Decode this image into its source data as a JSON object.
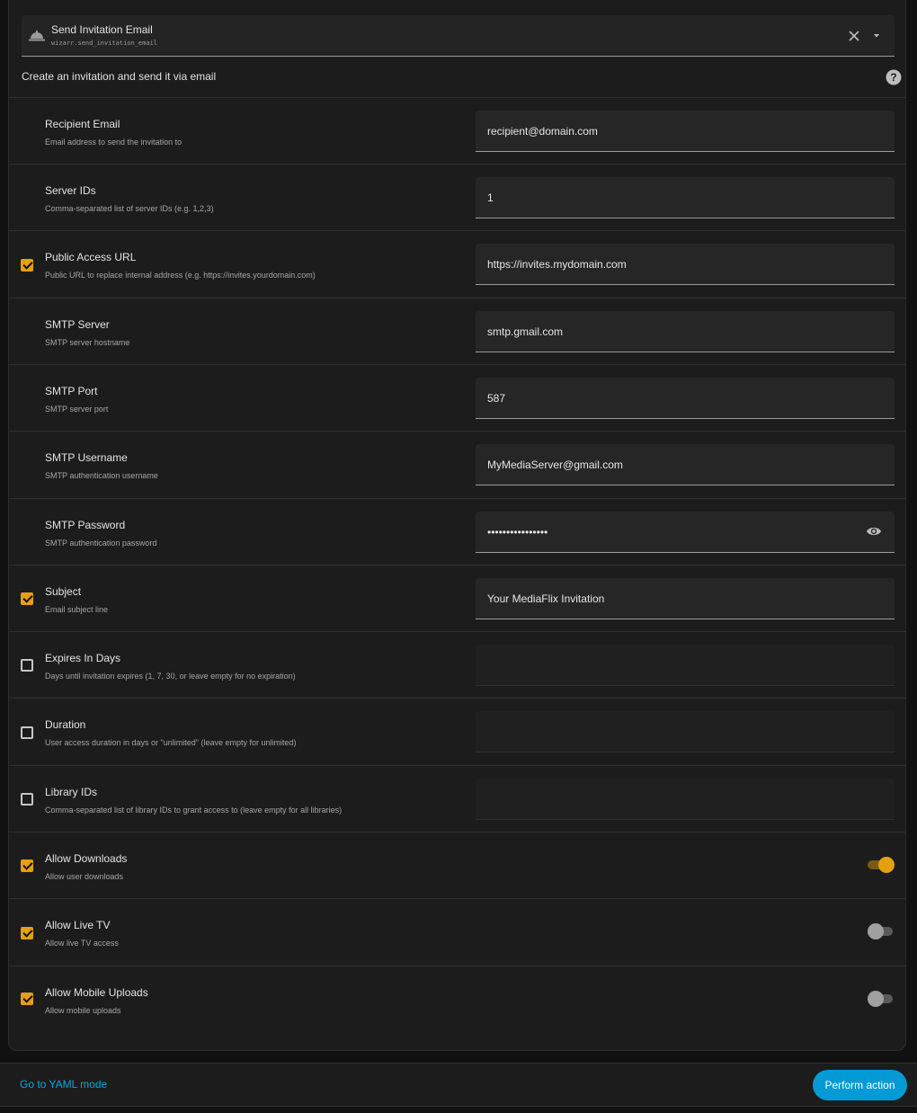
{
  "service": {
    "name": "Send Invitation Email",
    "id": "wizarr.send_invitation_email",
    "description": "Create an invitation and send it via email"
  },
  "fields": [
    {
      "label": "Recipient Email",
      "sub": "Email address to send the invitation to",
      "value": "recipient@domain.com",
      "checkbox": "none",
      "type": "text"
    },
    {
      "label": "Server IDs",
      "sub": "Comma-separated list of server IDs (e.g. 1,2,3)",
      "value": "1",
      "checkbox": "none",
      "type": "text"
    },
    {
      "label": "Public Access URL",
      "sub": "Public URL to replace internal address (e.g. https://invites.yourdomain.com)",
      "value": "https://invites.mydomain.com",
      "checkbox": "checked",
      "type": "text"
    },
    {
      "label": "SMTP Server",
      "sub": "SMTP server hostname",
      "value": "smtp.gmail.com",
      "checkbox": "none",
      "type": "text"
    },
    {
      "label": "SMTP Port",
      "sub": "SMTP server port",
      "value": "587",
      "checkbox": "none",
      "type": "text"
    },
    {
      "label": "SMTP Username",
      "sub": "SMTP authentication username",
      "value": "MyMediaServer@gmail.com",
      "checkbox": "none",
      "type": "text"
    },
    {
      "label": "SMTP Password",
      "sub": "SMTP authentication password",
      "value": "••••••••••••••••",
      "checkbox": "none",
      "type": "password"
    },
    {
      "label": "Subject",
      "sub": "Email subject line",
      "value": "Your MediaFlix Invitation",
      "checkbox": "checked",
      "type": "text"
    },
    {
      "label": "Expires In Days",
      "sub": "Days until invitation expires (1, 7, 30, or leave empty for no expiration)",
      "value": "",
      "checkbox": "unchecked",
      "type": "empty"
    },
    {
      "label": "Duration",
      "sub": "User access duration in days or \"unlimited\" (leave empty for unlimited)",
      "value": "",
      "checkbox": "unchecked",
      "type": "empty"
    },
    {
      "label": "Library IDs",
      "sub": "Comma-separated list of library IDs to grant access to (leave empty for all libraries)",
      "value": "",
      "checkbox": "unchecked",
      "type": "empty"
    },
    {
      "label": "Allow Downloads",
      "sub": "Allow user downloads",
      "checkbox": "checked",
      "type": "toggle",
      "toggle_on": true
    },
    {
      "label": "Allow Live TV",
      "sub": "Allow live TV access",
      "checkbox": "checked",
      "type": "toggle",
      "toggle_on": false
    },
    {
      "label": "Allow Mobile Uploads",
      "sub": "Allow mobile uploads",
      "checkbox": "checked",
      "type": "toggle",
      "toggle_on": false
    }
  ],
  "footer": {
    "yaml_link": "Go to YAML mode",
    "perform_button": "Perform action"
  },
  "colors": {
    "accent": "#e3a10c",
    "primary": "#029ad4",
    "link": "#0fa5d8"
  },
  "icons": {
    "service": "service-bell-icon",
    "clear": "close-icon",
    "dropdown": "caret-down-icon",
    "help": "help-circle-icon",
    "reveal": "eye-icon"
  }
}
